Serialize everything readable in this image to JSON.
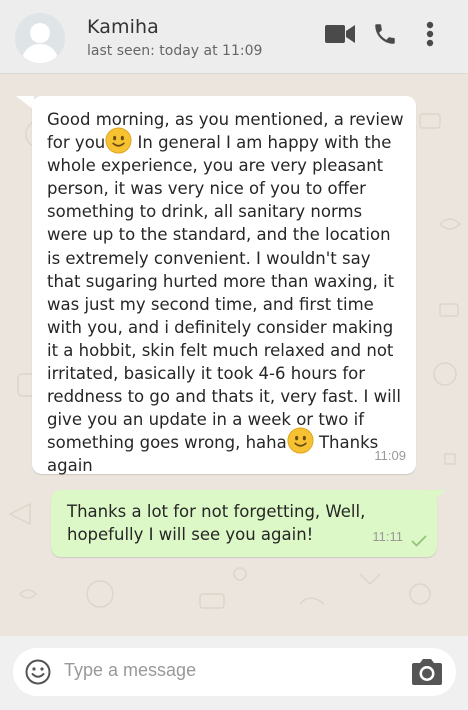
{
  "header": {
    "contact_name": "Kamiha",
    "last_seen": "last seen: today at 11:09",
    "icons": [
      "avatar-placeholder",
      "video-call-icon",
      "phone-call-icon",
      "more-vert-icon"
    ]
  },
  "messages": [
    {
      "direction": "incoming",
      "parts": [
        "Good morning, as you mentioned, a review for you",
        " In general I am happy with the whole experience, you are very pleasant person, it was very nice of you to offer something to drink, all sanitary norms were up to the standard, and the location is extremely convenient. I wouldn't say that sugaring hurted more than waxing, it was just my second time, and first time with you, and i definitely consider making it a hobbit, skin felt much relaxed and not irritated, basically it took 4-6 hours for reddness to go and thats it, very fast. I will give you an update in a week or two if something goes wrong, haha",
        " Thanks again"
      ],
      "emojis": [
        "slightly-smiling-face",
        "slightly-smiling-face"
      ],
      "time": "11:09"
    },
    {
      "direction": "outgoing",
      "text": "Thanks a lot for not forgetting, Well, hopefully I will see you again!",
      "time": "11:11",
      "status": "sent-single-check"
    }
  ],
  "composer": {
    "placeholder": "Type a message",
    "icons": [
      "emoji-icon",
      "camera-icon"
    ]
  },
  "colors": {
    "header_bg": "#ededed",
    "chat_bg": "#ece5dd",
    "incoming_bubble": "#ffffff",
    "outgoing_bubble": "#dcf8c6",
    "icon_gray": "#4a4a4a",
    "emoji_yellow": "#f7c232"
  }
}
